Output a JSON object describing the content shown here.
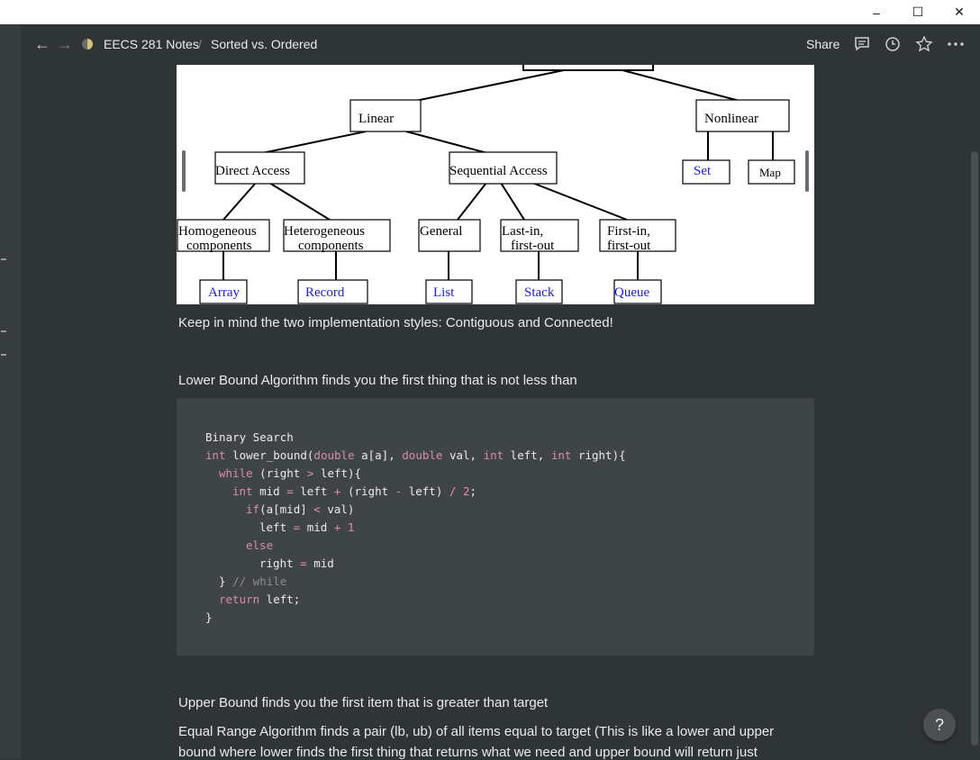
{
  "window": {
    "minimize_glyph": "–",
    "maximize_glyph": "☐",
    "close_glyph": "✕"
  },
  "topbar": {
    "back_glyph": "←",
    "forward_glyph": "→",
    "breadcrumb_parent": "EECS 281 Notes",
    "breadcrumb_separator": "/",
    "breadcrumb_current": "Sorted vs. Ordered",
    "share_label": "Share",
    "icons": [
      "comment-icon",
      "history-icon",
      "star-icon",
      "more-icon"
    ]
  },
  "diagram": {
    "nodes": {
      "linear": "Linear",
      "nonlinear": "Nonlinear",
      "direct_access": "Direct Access",
      "sequential_access": "Sequential Access",
      "set": "Set",
      "map": "Map",
      "homogeneous_1": "Homogeneous",
      "homogeneous_2": "components",
      "heterogeneous_1": "Heterogeneous",
      "heterogeneous_2": "components",
      "general": "General",
      "lifo_1": "Last-in,",
      "lifo_2": "first-out",
      "fifo_1": "First-in,",
      "fifo_2": "first-out",
      "array": "Array",
      "record": "Record",
      "list": "List",
      "stack": "Stack",
      "queue": "Queue"
    },
    "link_color": "#1a1ae6"
  },
  "content": {
    "p1": "Keep in mind the two implementation styles: Contiguous and Connected!",
    "p2": "Lower Bound Algorithm finds you the first thing that is not less than",
    "code_title": "Binary Search",
    "p3": "Upper Bound finds you the first item that is greater than target",
    "p4_line1": "Equal Range Algorithm finds a pair (lb, ub) of all items equal to target (This is like a lower and upper",
    "p4_line2": "bound where lower finds the first thing that returns what we need and upper bound will return just"
  },
  "help": {
    "label": "?"
  },
  "colors": {
    "background": "#2f3437",
    "code_bg": "#3f4447",
    "keyword": "#d78ea8"
  }
}
